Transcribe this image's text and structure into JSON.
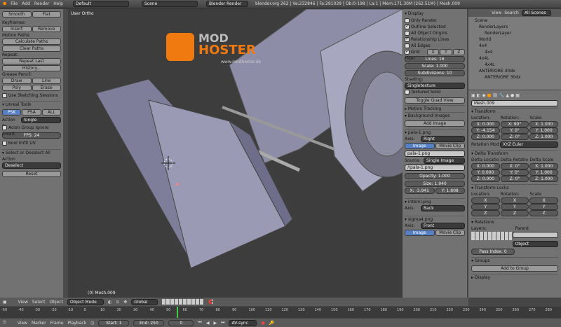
{
  "topbar": {
    "menus": [
      "File",
      "Add",
      "Render",
      "Help"
    ],
    "layout": "Default",
    "scene": "Scene",
    "engine": "Blender Render",
    "stats": "blender.org 262 | Ve:232846 | Fa:291039 | Ob:0-198 | La:1 | Mem:171.30M (262.51M) | Mesh.009"
  },
  "toolshelf": {
    "smooth": "Smooth",
    "flat": "Flat",
    "keyframes_title": "Keyframes:",
    "insert": "Insert",
    "remove": "Remove",
    "motion_title": "Motion Paths:",
    "calc_paths": "Calculate Paths",
    "clear_paths": "Clear Paths",
    "repeat_title": "Repeat:",
    "repeat_last": "Repeat Last",
    "history": "History...",
    "grease_title": "Grease Pencil:",
    "draw": "Draw",
    "line": "Line",
    "poly": "Poly",
    "erase": "Erase",
    "use_sketching": "Use Sketching Sessions",
    "unreal_title": "Unreal Tools",
    "psk": "PSK",
    "psa": "PSA",
    "all": "ALL",
    "action_s_label": "Action S:",
    "action_s_value": "Single",
    "action_group": "Acion Group Ignore Count",
    "fps": "FPS: 24",
    "bool_uv": "bool Imfit UV",
    "op_title": "Select or Deselect All",
    "action_label": "Action",
    "action_value": "Deselect",
    "reset": "Reset"
  },
  "viewport": {
    "view_name": "User Ortho",
    "object_name": "(0) Mesh.009",
    "watermark_mod": "MOD",
    "watermark_hoster": "HOSTER",
    "watermark_url": "www.modhoster.de"
  },
  "npanel": {
    "display_title": "Display",
    "only_render": "Only Render",
    "outline_selected": "Outline Selected",
    "all_origins": "All Object Origins",
    "relationship_lines": "Relationship Lines",
    "all_edges": "All Edges",
    "grid_floor": "Grid Floor",
    "x": "X",
    "y": "Y",
    "z": "Z",
    "lines": "Lines: 16",
    "scale": "Scale: 1.000",
    "subdivisions": "Subdivisions: 10",
    "shading_label": "Shading:",
    "shading_value": "Singletexture",
    "textured_solid": "Textured Solid",
    "toggle_quad": "Toggle Quad View",
    "motion_tracking": "Motion Tracking",
    "bg_images": "Background Images",
    "add_image": "Add Image",
    "img1": "pala-1.png",
    "axis_label": "Axis:",
    "axis_right": "Right",
    "image_tab": "Image",
    "movie_tab": "Movie Clip",
    "img1_file": "pala-1.png",
    "source_label": "Source:",
    "source_value": "Single Image",
    "img1_path": "//pala-1.png",
    "opacity": "Opacity: 1.000",
    "size": "Size: 1.940",
    "xoff": "X: -3.941",
    "yoff": "Y: 1.808",
    "img2": "interni.png",
    "axis_back": "Back",
    "img3": "sigma4.png",
    "axis_front": "Front"
  },
  "outliner": {
    "view": "View",
    "search": "Search",
    "scenes": "All Scenes",
    "items": [
      "Scene",
      "RenderLayers",
      "RenderLayer",
      "World",
      "4x4",
      "4x4",
      "4x4L",
      "4x4L",
      "ANTERIORE 30dx",
      "ANTERIORE 30dx"
    ]
  },
  "properties": {
    "mesh_name": "Mesh.009",
    "transform": "Transform",
    "location": "Location:",
    "rotation": "Rotation:",
    "scale": "Scale:",
    "loc": [
      "X: 0.000",
      "Y: -4.154",
      "Z: 0.000"
    ],
    "rot": [
      "X: 90°",
      "Y: 0°",
      "Z: 0°"
    ],
    "scl": [
      "X: 1.000",
      "Y: 1.000",
      "Z: 1.000"
    ],
    "rot_mode_label": "Rotation Mod",
    "rot_mode": "XYZ Euler",
    "delta": "Delta Transform",
    "dloc_label": "Delta Locatio",
    "drot_label": "Delta Rotatio",
    "dscl_label": "Delta Scale",
    "dloc": [
      "X: 0.000",
      "Y: 0.000",
      "Z: 0.000"
    ],
    "drot": [
      "X: 0°",
      "Y: 0°",
      "Z: 0°"
    ],
    "dscl": [
      "X: 1.000",
      "Y: 1.000",
      "Z: 1.000"
    ],
    "locks": "Transform Locks",
    "lock_loc": "Location:",
    "lock_rot": "Rotation:",
    "lock_scl": "Scale:",
    "lock_axes": [
      "X",
      "Y",
      "Z"
    ],
    "relations": "Relations",
    "layers": "Layers:",
    "parent": "Parent:",
    "object": "Object",
    "pass_index": "Pass Index: 0",
    "groups": "Groups",
    "add_group": "Add to Group",
    "display": "Display"
  },
  "header3d": {
    "view": "View",
    "select": "Select",
    "object": "Object",
    "mode": "Object Mode",
    "orientation": "Global"
  },
  "timeline": {
    "ticks": [
      "-50",
      "-40",
      "-30",
      "-20",
      "-10",
      "0",
      "10",
      "20",
      "30",
      "40",
      "50",
      "60",
      "70",
      "80",
      "90",
      "100",
      "110",
      "120",
      "130",
      "140",
      "150",
      "160",
      "170",
      "180",
      "190",
      "200",
      "210",
      "220",
      "230",
      "240",
      "250",
      "260",
      "270",
      "280"
    ],
    "view": "View",
    "marker": "Marker",
    "frame": "Frame",
    "playback": "Playback",
    "start": "Start: 1",
    "end": "End: 250",
    "current": "0",
    "sync": "AV-sync"
  }
}
